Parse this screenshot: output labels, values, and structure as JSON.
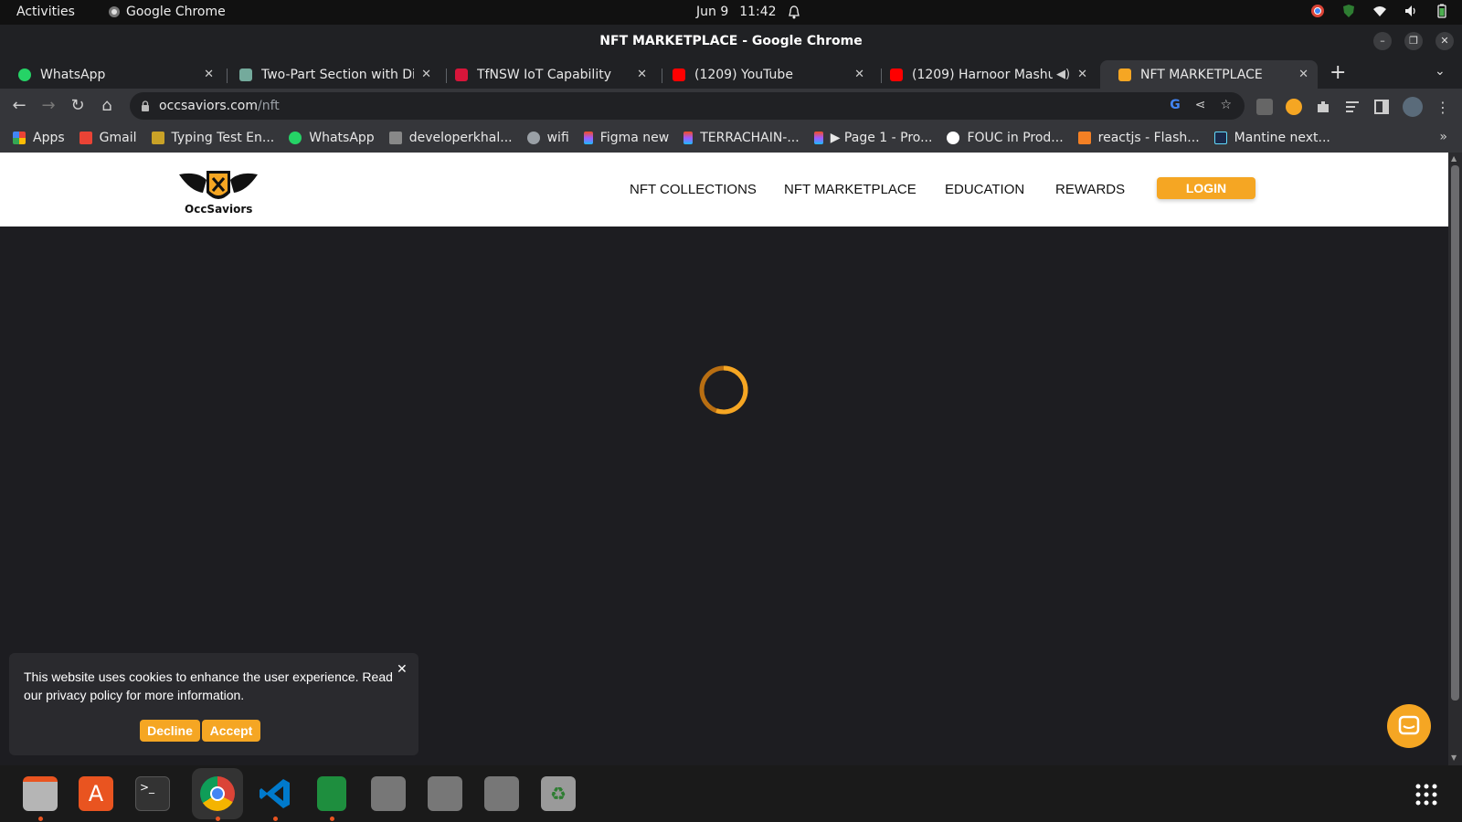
{
  "system_bar": {
    "activities": "Activities",
    "app_name": "Google Chrome",
    "date": "Jun 9",
    "time": "11:42"
  },
  "window": {
    "title": "NFT MARKETPLACE - Google Chrome"
  },
  "tabs": [
    {
      "title": "WhatsApp",
      "icon": "whatsapp-icon",
      "color": "#25d366"
    },
    {
      "title": "Two-Part Section with Div",
      "icon": "chatgpt-icon",
      "color": "#74aa9c"
    },
    {
      "title": "TfNSW IoT Capability",
      "icon": "nsw-icon",
      "color": "#d7153a"
    },
    {
      "title": "(1209) YouTube",
      "icon": "youtube-icon",
      "color": "#ff0000"
    },
    {
      "title": "(1209) Harnoor Mashu",
      "icon": "youtube-icon",
      "color": "#ff0000"
    },
    {
      "title": "NFT MARKETPLACE",
      "icon": "occsaviors-icon",
      "color": "#f5a623"
    }
  ],
  "address_bar": {
    "host": "occsaviors.com",
    "path": "/nft"
  },
  "bookmarks": [
    {
      "label": "Apps",
      "icon": "apps-grid-icon",
      "color": "#4285f4"
    },
    {
      "label": "Gmail",
      "icon": "gmail-icon",
      "color": "#ea4335"
    },
    {
      "label": "Typing Test En...",
      "icon": "typing-icon",
      "color": "#c9a227"
    },
    {
      "label": "WhatsApp",
      "icon": "whatsapp-icon",
      "color": "#25d366"
    },
    {
      "label": "developerkhal...",
      "icon": "dev-icon",
      "color": "#888888"
    },
    {
      "label": "wifi",
      "icon": "globe-icon",
      "color": "#9aa0a6"
    },
    {
      "label": "Figma new",
      "icon": "figma-icon",
      "color": "#f24e1e"
    },
    {
      "label": "TERRACHAIN-...",
      "icon": "figma-icon",
      "color": "#a259ff"
    },
    {
      "label": "▶ Page 1 - Pro...",
      "icon": "figma-icon",
      "color": "#f24e1e"
    },
    {
      "label": "FOUC in Prod...",
      "icon": "github-icon",
      "color": "#ffffff"
    },
    {
      "label": "reactjs - Flash...",
      "icon": "stackoverflow-icon",
      "color": "#f48024"
    },
    {
      "label": "Mantine next...",
      "icon": "react-icon",
      "color": "#61dafb"
    }
  ],
  "site": {
    "logo_text": "OccSaviors",
    "nav": [
      "NFT COLLECTIONS",
      "NFT MARKETPLACE",
      "EDUCATION",
      "REWARDS"
    ],
    "login_label": "LOGIN",
    "accent_color": "#f5a623",
    "background_color": "#1d1d21"
  },
  "cookie_banner": {
    "message": "This website uses cookies to enhance the user experience. Read our privacy policy for more information.",
    "decline_label": "Decline",
    "accept_label": "Accept",
    "close_glyph": "✕"
  },
  "dock": [
    {
      "name": "files-icon",
      "color": "#b5b5b5",
      "running": true
    },
    {
      "name": "software-center-icon",
      "color": "#e95420",
      "running": false
    },
    {
      "name": "terminal-icon",
      "color": "#333333",
      "running": false
    },
    {
      "name": "chrome-icon",
      "color": "#4285f4",
      "running": true
    },
    {
      "name": "vscode-icon",
      "color": "#007acc",
      "running": true
    },
    {
      "name": "spreadsheet-icon",
      "color": "#1e8e3e",
      "running": true
    },
    {
      "name": "disk-icon",
      "color": "#777777",
      "running": false
    },
    {
      "name": "disk-icon",
      "color": "#777777",
      "running": false
    },
    {
      "name": "disk-icon",
      "color": "#777777",
      "running": false
    },
    {
      "name": "trash-icon",
      "color": "#9a9a9a",
      "running": false
    }
  ]
}
